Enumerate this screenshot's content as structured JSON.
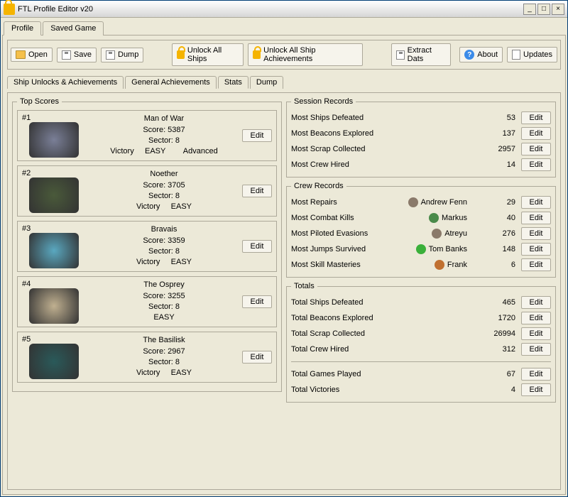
{
  "window": {
    "title": "FTL Profile Editor v20"
  },
  "mainTabs": {
    "profile": "Profile",
    "savedGame": "Saved Game"
  },
  "toolbar": {
    "open": "Open",
    "save": "Save",
    "dump": "Dump",
    "unlockShips": "Unlock All Ships",
    "unlockAch": "Unlock All Ship Achievements",
    "extractDats": "Extract Dats",
    "about": "About",
    "updates": "Updates"
  },
  "subTabs": {
    "unlocks": "Ship Unlocks & Achievements",
    "general": "General Achievements",
    "stats": "Stats",
    "dump": "Dump"
  },
  "labels": {
    "topScores": "Top Scores",
    "sessionRecords": "Session Records",
    "crewRecords": "Crew Records",
    "totals": "Totals",
    "edit": "Edit",
    "score": "Score:",
    "sector": "Sector:",
    "victory": "Victory",
    "easy": "EASY",
    "advanced": "Advanced"
  },
  "topScores": [
    {
      "rank": "#1",
      "ship": "Man of War",
      "score": "5387",
      "sector": "8",
      "victory": true,
      "diff": "EASY",
      "extra": "Advanced",
      "color": "#7a7f97"
    },
    {
      "rank": "#2",
      "ship": "Noether",
      "score": "3705",
      "sector": "8",
      "victory": true,
      "diff": "EASY",
      "extra": "",
      "color": "#4a5a3a"
    },
    {
      "rank": "#3",
      "ship": "Bravais",
      "score": "3359",
      "sector": "8",
      "victory": true,
      "diff": "EASY",
      "extra": "",
      "color": "#5aa8c0"
    },
    {
      "rank": "#4",
      "ship": "The Osprey",
      "score": "3255",
      "sector": "8",
      "victory": false,
      "diff": "EASY",
      "extra": "",
      "color": "#c0b090"
    },
    {
      "rank": "#5",
      "ship": "The Basilisk",
      "score": "2967",
      "sector": "8",
      "victory": true,
      "diff": "EASY",
      "extra": "",
      "color": "#2a5a5a"
    }
  ],
  "session": [
    {
      "label": "Most Ships Defeated",
      "value": "53"
    },
    {
      "label": "Most Beacons Explored",
      "value": "137"
    },
    {
      "label": "Most Scrap Collected",
      "value": "2957"
    },
    {
      "label": "Most Crew Hired",
      "value": "14"
    }
  ],
  "crew": [
    {
      "label": "Most Repairs",
      "name": "Andrew Fenn",
      "value": "29",
      "color": "#8a7a6a"
    },
    {
      "label": "Most Combat Kills",
      "name": "Markus",
      "value": "40",
      "color": "#4a8a4a"
    },
    {
      "label": "Most Piloted Evasions",
      "name": "Atreyu",
      "value": "276",
      "color": "#8a7a6a"
    },
    {
      "label": "Most Jumps Survived",
      "name": "Tom Banks",
      "value": "148",
      "color": "#3ab03a"
    },
    {
      "label": "Most Skill Masteries",
      "name": "Frank",
      "value": "6",
      "color": "#c07030"
    }
  ],
  "totals": [
    {
      "label": "Total Ships Defeated",
      "value": "465"
    },
    {
      "label": "Total Beacons Explored",
      "value": "1720"
    },
    {
      "label": "Total Scrap Collected",
      "value": "26994"
    },
    {
      "label": "Total Crew Hired",
      "value": "312"
    }
  ],
  "totals2": [
    {
      "label": "Total Games Played",
      "value": "67"
    },
    {
      "label": "Total Victories",
      "value": "4"
    }
  ]
}
